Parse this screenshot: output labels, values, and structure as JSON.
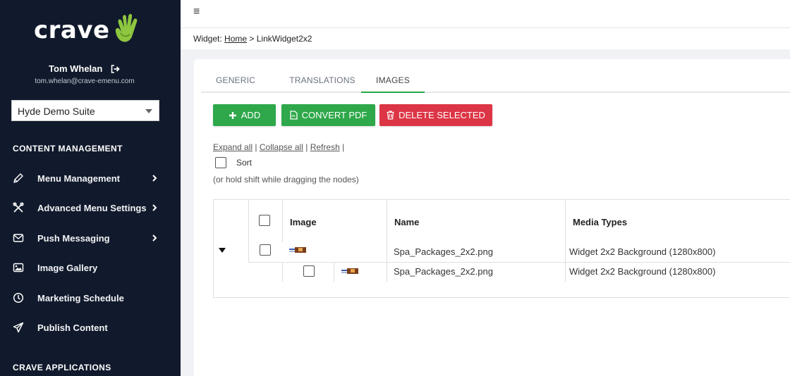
{
  "brand": {
    "name": "crave",
    "accent": "#8dc63f"
  },
  "user": {
    "name": "Tom Whelan",
    "email": "tom.whelan@crave-emenu.com"
  },
  "suite_select": {
    "value": "Hyde Demo Suite"
  },
  "sections": {
    "content": "CONTENT MANAGEMENT",
    "apps": "CRAVE APPLICATIONS"
  },
  "nav": [
    {
      "label": "Menu Management",
      "icon": "pencil-icon",
      "has_children": true
    },
    {
      "label": "Advanced Menu Settings",
      "icon": "tools-icon",
      "has_children": true
    },
    {
      "label": "Push Messaging",
      "icon": "envelope-icon",
      "has_children": true
    },
    {
      "label": "Image Gallery",
      "icon": "image-icon",
      "has_children": false
    },
    {
      "label": "Marketing Schedule",
      "icon": "clock-icon",
      "has_children": false
    },
    {
      "label": "Publish Content",
      "icon": "paper-plane-icon",
      "has_children": false
    }
  ],
  "breadcrumb": {
    "prefix": "Widget:",
    "home": "Home",
    "separator": ">",
    "current": "LinkWidget2x2"
  },
  "tabs": [
    {
      "label": "GENERIC",
      "active": false
    },
    {
      "label": "TRANSLATIONS",
      "active": false
    },
    {
      "label": "IMAGES",
      "active": true
    }
  ],
  "buttons": {
    "add": "ADD",
    "convert": "CONVERT PDF",
    "delete": "DELETE SELECTED"
  },
  "tree_links": {
    "expand": "Expand all",
    "collapse": "Collapse all",
    "refresh": "Refresh",
    "sep": "|"
  },
  "sort": {
    "label": "Sort",
    "checked": false,
    "hint": "(or hold shift while dragging the nodes)"
  },
  "grid": {
    "columns": [
      "Image",
      "Name",
      "Media Types"
    ],
    "rows": [
      {
        "name": "Spa_Packages_2x2.png",
        "media_type": "Widget 2x2 Background (1280x800)",
        "level": 0,
        "expanded": true,
        "checked": false
      },
      {
        "name": "Spa_Packages_2x2.png",
        "media_type": "Widget 2x2 Background (1280x800)",
        "level": 1,
        "checked": false
      }
    ]
  },
  "colors": {
    "sidebar_bg": "#111a2c",
    "green": "#2ea84a",
    "red": "#dc3545",
    "tab_active": "#28a745"
  }
}
